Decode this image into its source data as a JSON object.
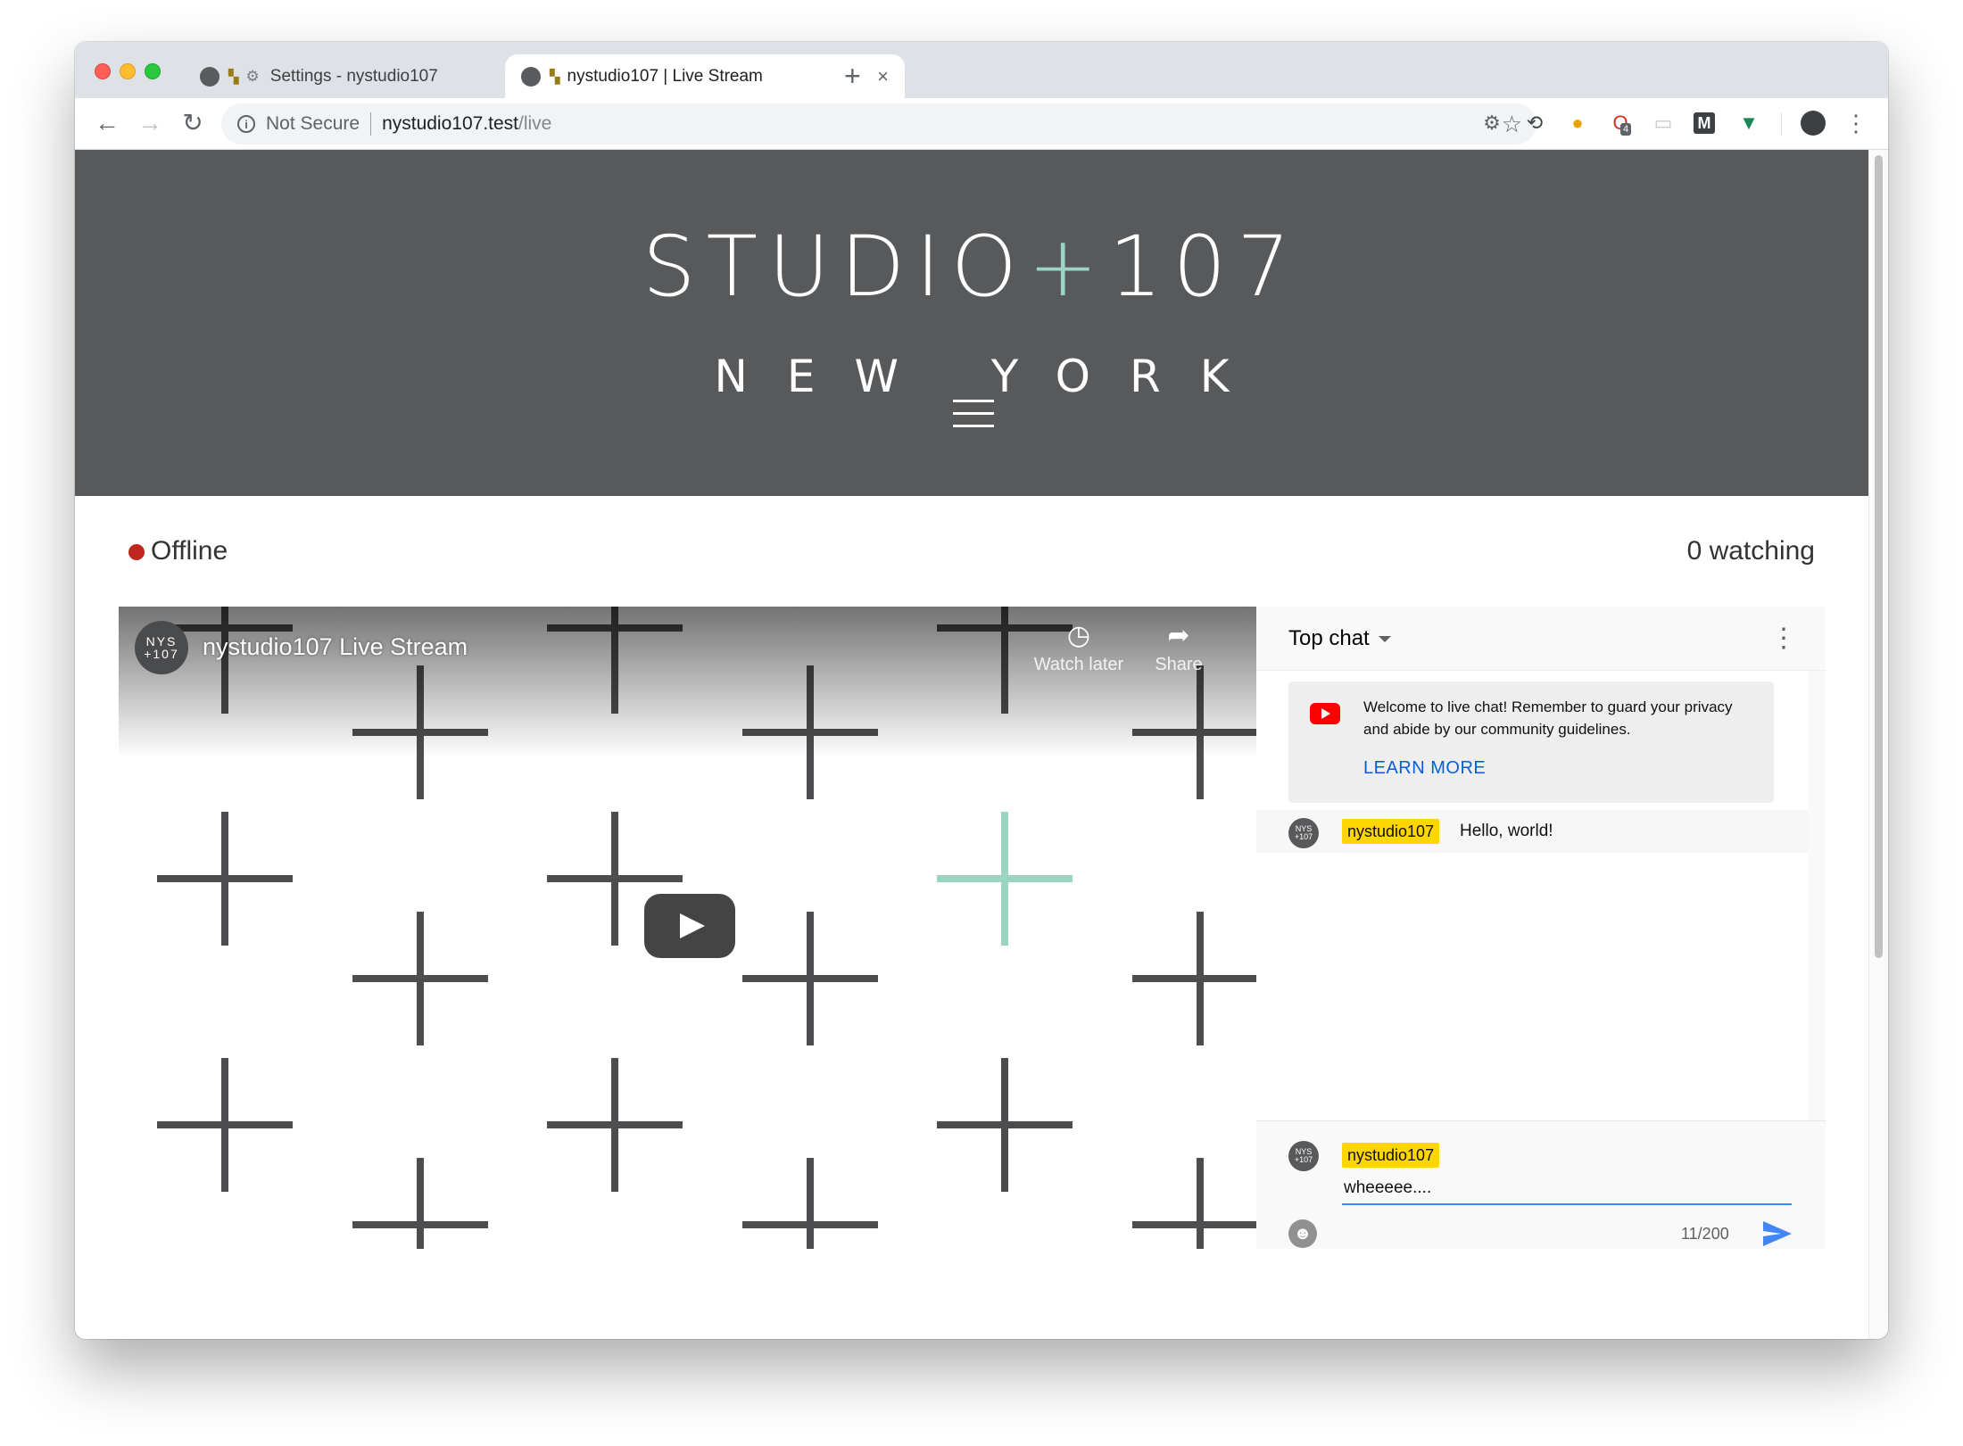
{
  "browser": {
    "tabs": [
      {
        "title": "Settings - nystudio107"
      },
      {
        "title": "nystudio107 | Live Stream"
      }
    ],
    "new_tab_label": "+",
    "not_secure": "Not Secure",
    "url_host": "nystudio107.test",
    "url_path": "/live",
    "extension_badge": "4"
  },
  "hero": {
    "logo_left": "STUDIO",
    "logo_plus": "+",
    "logo_right": "107",
    "logo_sub": "NEW YORK"
  },
  "status": {
    "state": "Offline",
    "viewers": "0 watching"
  },
  "video": {
    "channel_avatar_text": "NYS +107",
    "title": "nystudio107 Live Stream",
    "watch_later_label": "Watch later",
    "share_label": "Share"
  },
  "chat": {
    "mode": "Top chat",
    "welcome_text": "Welcome to live chat! Remember to guard your privacy and abide by our community guidelines.",
    "learn_more": "LEARN MORE",
    "messages": [
      {
        "author": "nystudio107",
        "text": "Hello, world!",
        "avatar_text": "NYS +107"
      }
    ],
    "input_author": "nystudio107",
    "input_value": "wheeeee....",
    "char_count": "11/200"
  },
  "colors": {
    "hero_bg": "#58595b",
    "accent_teal": "#9bd4c3",
    "offline_red": "#c0271f",
    "author_chip": "#ffd600",
    "link_blue": "#065fd4",
    "input_underline": "#4285f4"
  }
}
